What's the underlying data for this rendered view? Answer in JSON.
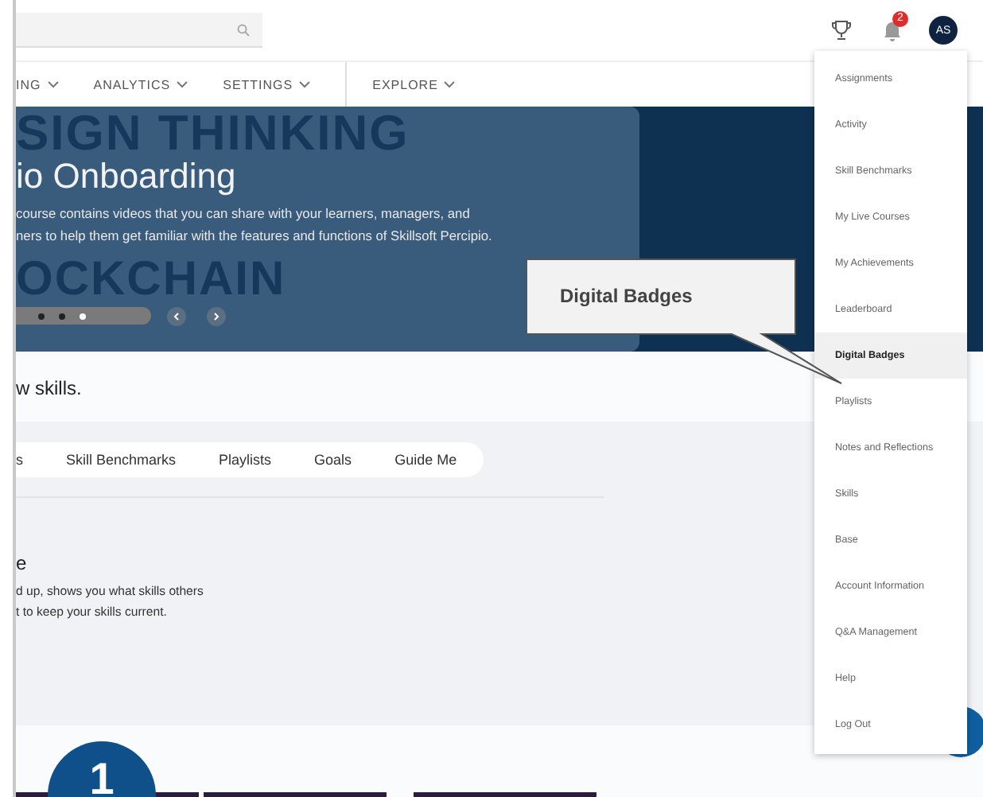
{
  "header": {
    "notification_count": "2",
    "avatar_initials": "AS"
  },
  "nav": [
    {
      "label": "ING"
    },
    {
      "label": "ANALYTICS"
    },
    {
      "label": "SETTINGS"
    },
    {
      "label": "EXPLORE"
    }
  ],
  "hero": {
    "background_text_top": "SIGN THINKING",
    "background_text_bottom": "OCKCHAIN",
    "title": "io Onboarding",
    "description": [
      "course contains videos that you can share with your learners, managers, and",
      "ners to help them get familiar with the features and functions of Skillsoft Percipio."
    ],
    "slides": [
      {
        "selected": false
      },
      {
        "selected": false
      },
      {
        "selected": true
      }
    ]
  },
  "intro": "w skills.",
  "tabs": [
    {
      "label": "s"
    },
    {
      "label": "Skill Benchmarks"
    },
    {
      "label": "Playlists"
    },
    {
      "label": "Goals"
    },
    {
      "label": "Guide Me"
    }
  ],
  "section": {
    "heading": "e",
    "lines": [
      "d up, shows you what skills others",
      "t to keep your skills current."
    ]
  },
  "step": {
    "number": "1"
  },
  "menu": [
    {
      "label": "Assignments",
      "selected": false
    },
    {
      "label": "Activity",
      "selected": false
    },
    {
      "label": "Skill Benchmarks",
      "selected": false
    },
    {
      "label": "My Live Courses",
      "selected": false
    },
    {
      "label": "My Achievements",
      "selected": false
    },
    {
      "label": "Leaderboard",
      "selected": false
    },
    {
      "label": "Digital Badges",
      "selected": true
    },
    {
      "label": "Playlists",
      "selected": false
    },
    {
      "label": "Notes and Reflections",
      "selected": false
    },
    {
      "label": "Skills",
      "selected": false
    },
    {
      "label": "Base",
      "selected": false
    },
    {
      "label": "Account Information",
      "selected": false
    },
    {
      "label": "Q&A Management",
      "selected": false
    },
    {
      "label": "Help",
      "selected": false
    },
    {
      "label": "Log Out",
      "selected": false
    }
  ],
  "callout": {
    "text": "Digital Badges"
  }
}
